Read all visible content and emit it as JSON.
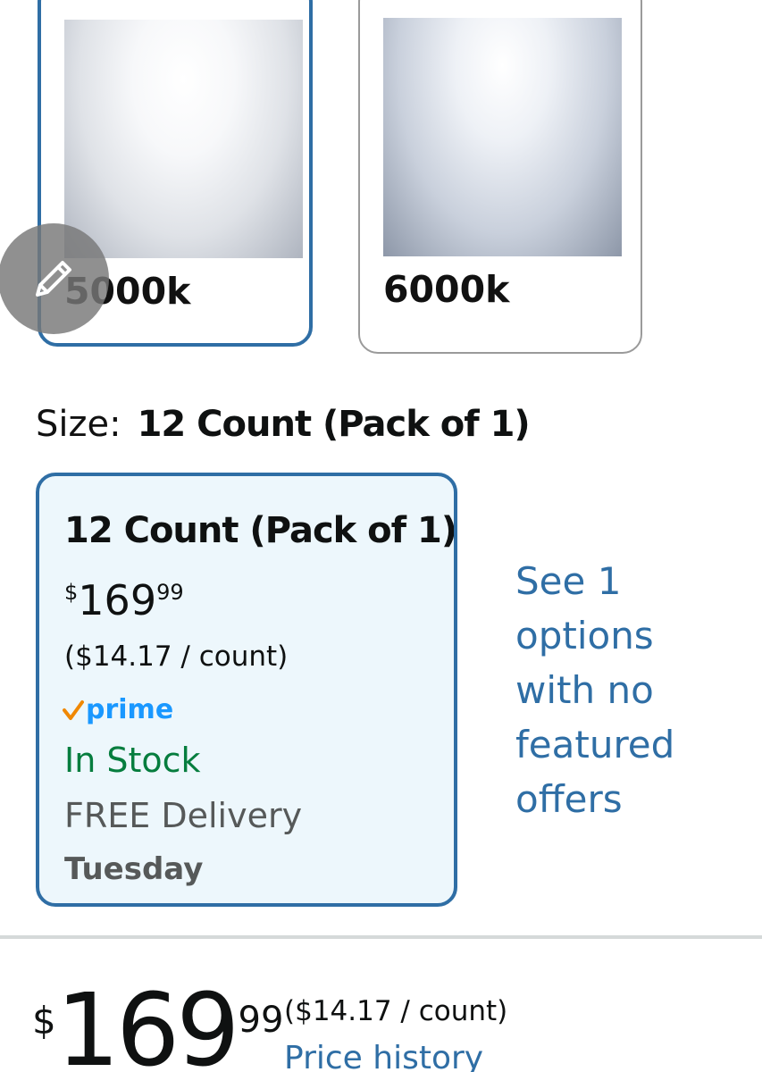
{
  "color_options": [
    {
      "label": "5000k",
      "selected": true
    },
    {
      "label": "6000k",
      "selected": false
    }
  ],
  "edit_button": {
    "icon": "pencil-icon"
  },
  "size": {
    "key_label": "Size:",
    "selected_value": "12 Count (Pack of 1)"
  },
  "size_card": {
    "title": "12 Count (Pack of 1)",
    "price_symbol": "$",
    "price_whole": "169",
    "price_fraction": "99",
    "unit_price": "($14.17 / count)",
    "prime_label": "prime",
    "stock_status": "In Stock",
    "delivery_text": "FREE Delivery",
    "delivery_day": "Tuesday"
  },
  "see_options": {
    "text": "See 1 options with no featured offers"
  },
  "price_block": {
    "symbol": "$",
    "whole": "169",
    "fraction": "99",
    "unit_price": "($14.17 / count)",
    "history_link": "Price history"
  },
  "colors": {
    "accent_blue": "#2f6ea5",
    "stock_green": "#067d3e",
    "prime_blue": "#1a98ff",
    "prime_orange": "#f08804",
    "card_bg": "#edf7fc"
  }
}
